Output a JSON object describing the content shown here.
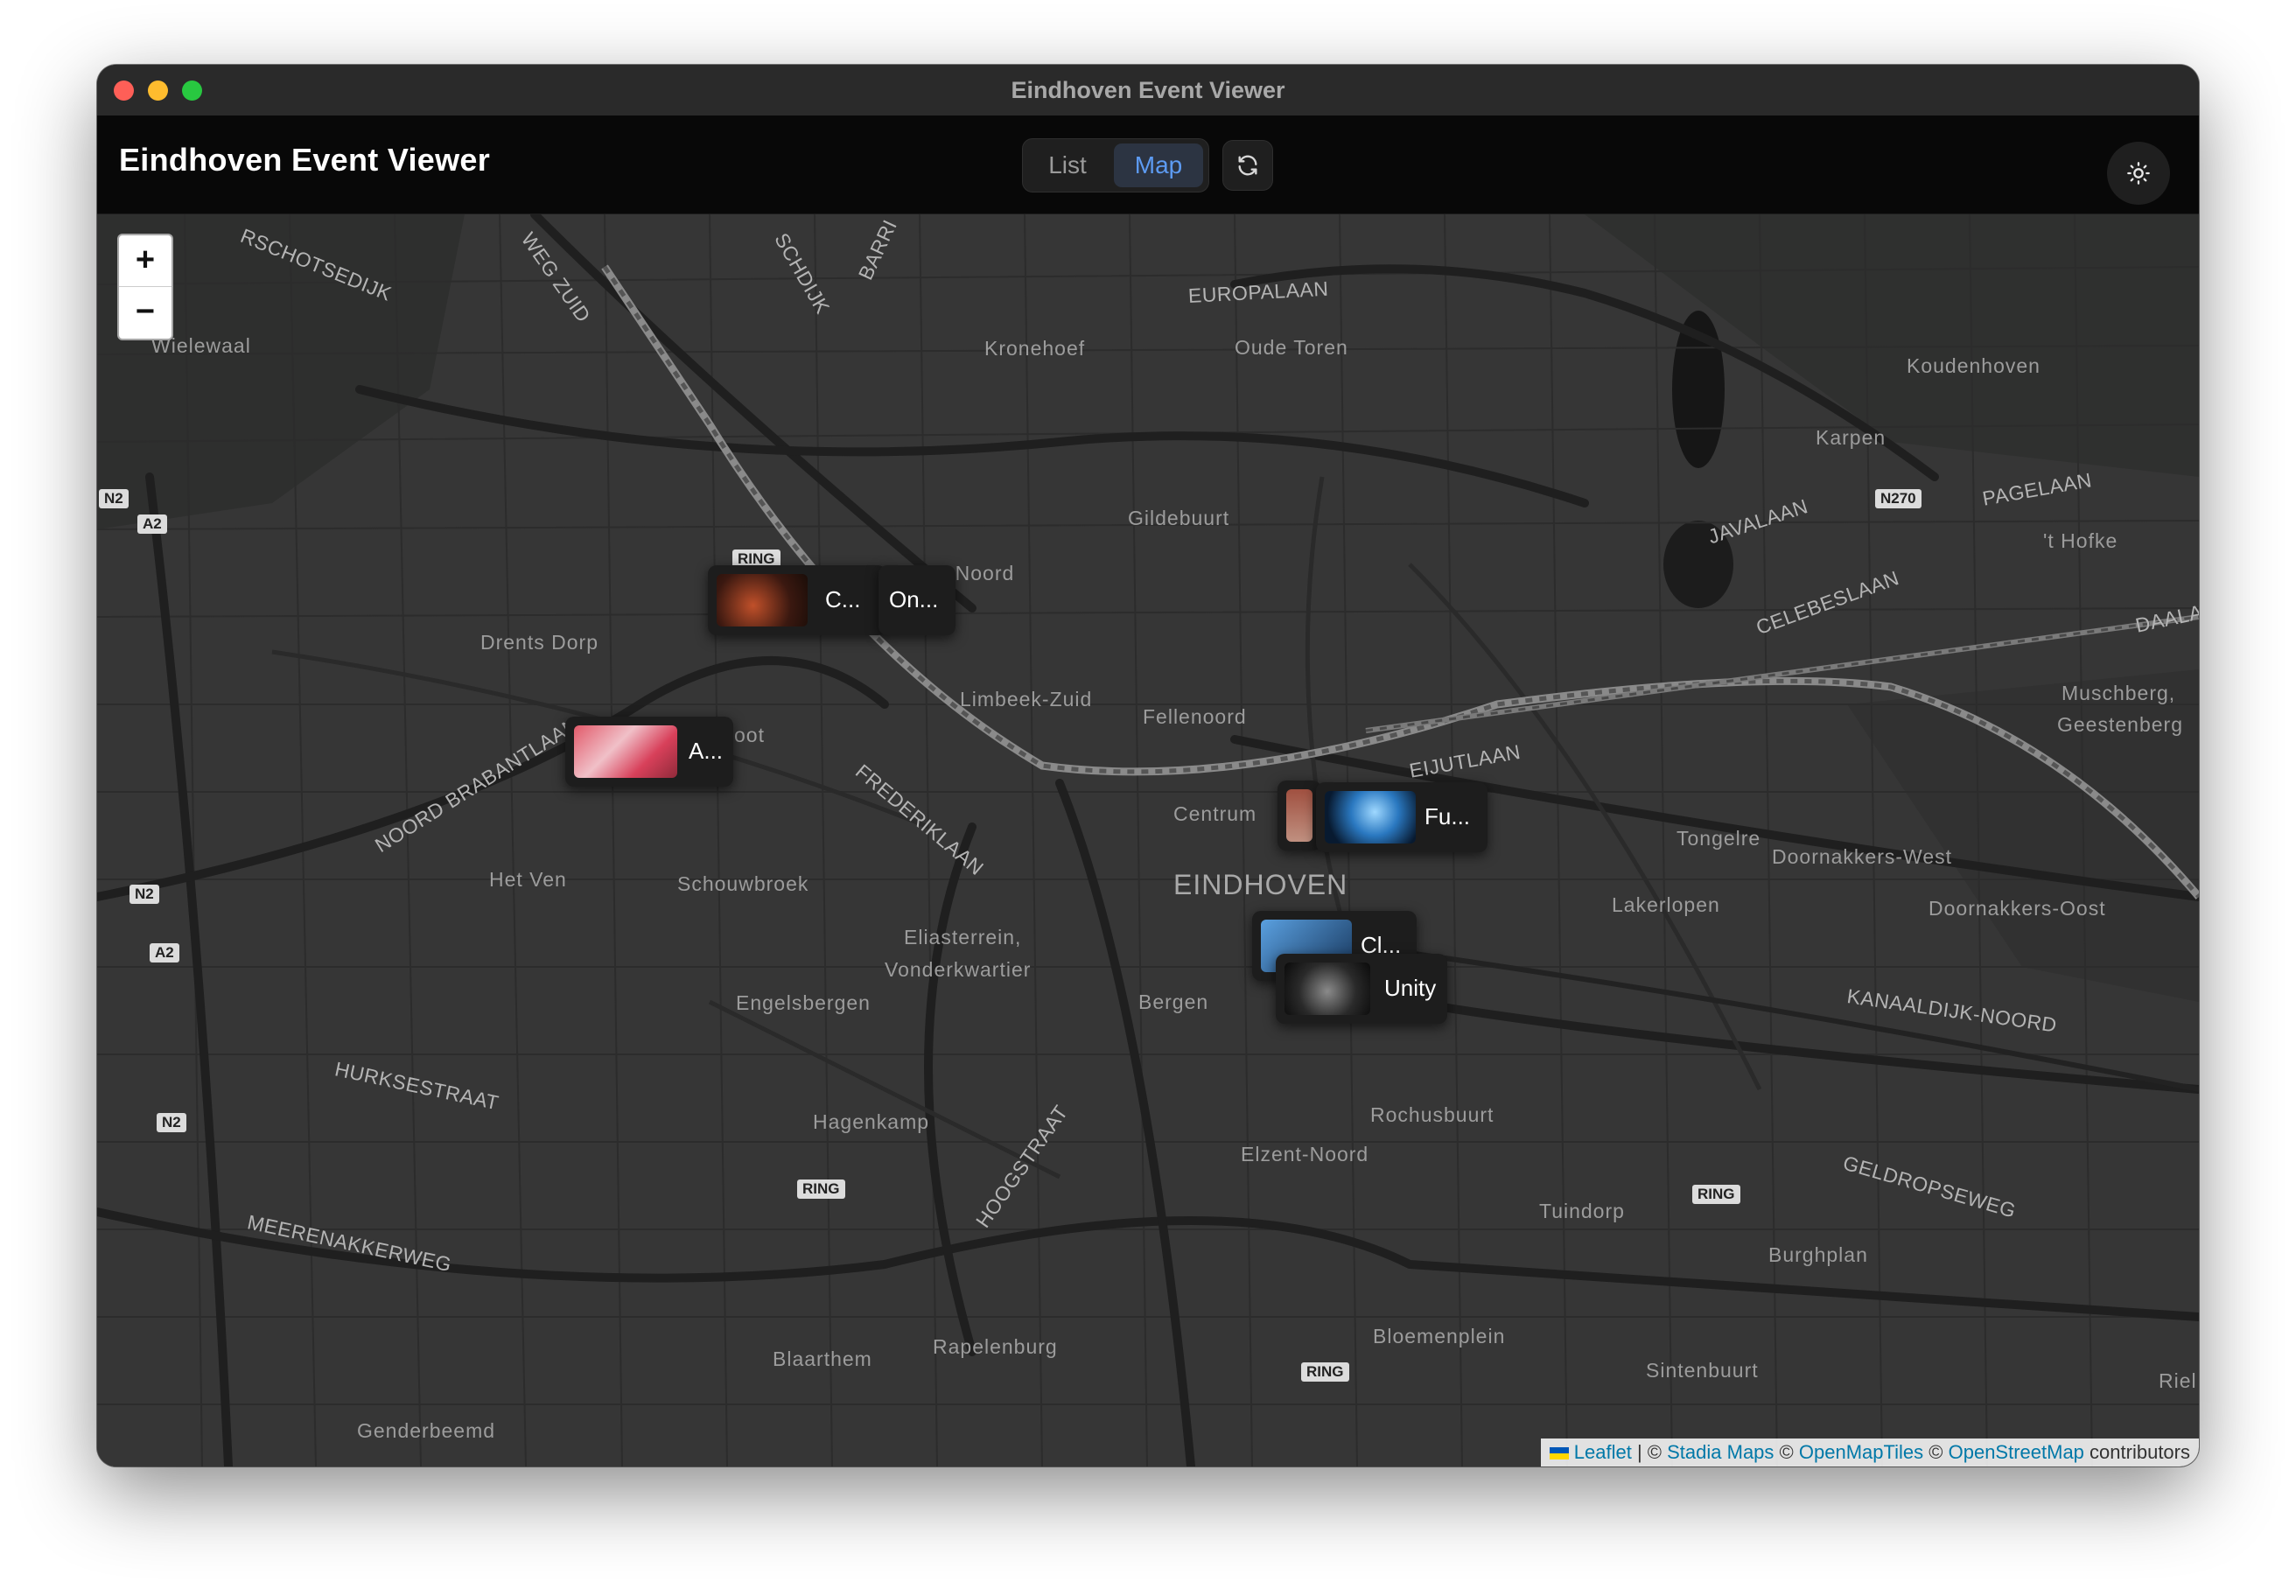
{
  "window": {
    "title": "Eindhoven Event Viewer"
  },
  "header": {
    "app_title": "Eindhoven Event Viewer",
    "view_toggle": {
      "options": [
        "List",
        "Map"
      ],
      "selected": "Map"
    },
    "refresh_icon": "refresh-icon",
    "theme_icon": "sun-icon"
  },
  "map": {
    "zoom_in_label": "+",
    "zoom_out_label": "−",
    "city_label": "EINDHOVEN",
    "places": [
      "Wielewaal",
      "Kronehoef",
      "Oude Toren",
      "Koudenhoven",
      "Karpen",
      "'t Hofke",
      "Gildebuurt",
      "-Noord",
      "Drents Dorp",
      "Limbeek-Zuid",
      "Fellenoord",
      "Muschberg,",
      "Geestenberg",
      "Centrum",
      "Tongelre",
      "Doornakkers-West",
      "Doornakkers-Oost",
      "Het Ven",
      "Schouwbroek",
      "Lakerlopen",
      "Eliasterrein,",
      "Vonderkwartier",
      "Engelsbergen",
      "Bergen",
      "Hagenkamp",
      "Rochusbuurt",
      "Elzent-Noord",
      "Tuindorp",
      "Burghplan",
      "Bloemenplein",
      "Sintenbuurt",
      "Blaarthem",
      "Rapelenburg",
      "Genderbeemd",
      "Riel",
      "oot"
    ],
    "roads": [
      "EUROPALAAN",
      "JAVALAAN",
      "PAGELAAN",
      "CELEBESLAAN",
      "DAALA",
      "NOORD BRABANTLAAN",
      "FREDERIKLAAN",
      "EIJUTLAAN",
      "KANAALDIJK-NOORD",
      "GELDROPSEWEG",
      "HURKSESTRAAT",
      "MEERENAKKERWEG",
      "HOOGSTRAAT",
      "RSCHOTSEDIJK",
      "WEG ZUID",
      "SCHDIJK",
      "BARRI"
    ],
    "shields": [
      "N2",
      "A2",
      "N2",
      "A2",
      "N2",
      "RING",
      "RING",
      "RING",
      "RING",
      "N270"
    ],
    "markers": [
      {
        "label": "C...",
        "thumb": "concert-dark-red"
      },
      {
        "label": "On...",
        "thumb": ""
      },
      {
        "label": "A...",
        "thumb": "stage-pink-lights"
      },
      {
        "label": "Fu...",
        "thumb": "crowd-blue-light"
      },
      {
        "label": "Cl...",
        "thumb": "club-blue"
      },
      {
        "label": "Unity",
        "thumb": "dj-decks"
      }
    ],
    "attribution": {
      "leaflet": "Leaflet",
      "sep1": "| ©",
      "stadia": "Stadia Maps",
      "sep2": "©",
      "omt": "OpenMapTiles",
      "sep3": "©",
      "osm": "OpenStreetMap",
      "tail": "contributors"
    }
  }
}
